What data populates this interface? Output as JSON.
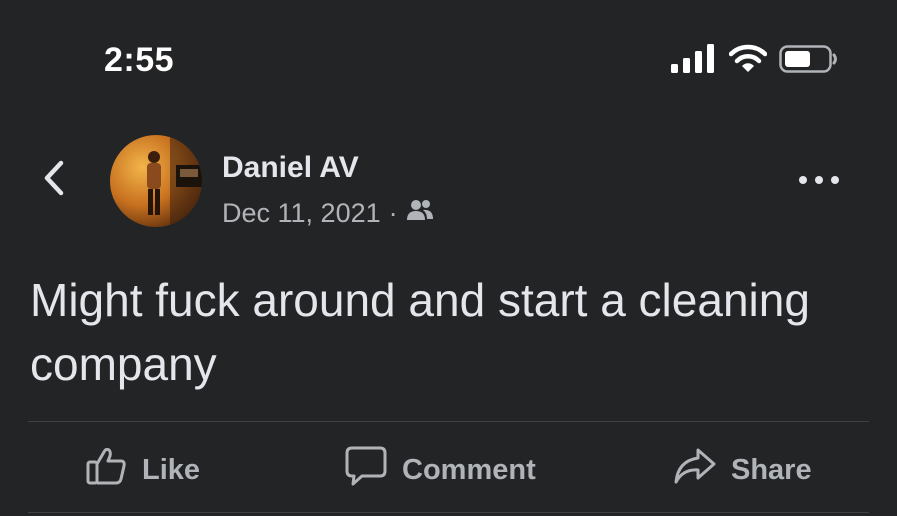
{
  "status_bar": {
    "time": "2:55",
    "icons": [
      "cellular-signal-icon",
      "wifi-icon",
      "battery-icon"
    ]
  },
  "nav": {
    "back_icon": "chevron-left-icon"
  },
  "post": {
    "author": "Daniel AV",
    "date": "Dec 11, 2021",
    "separator": "·",
    "audience_icon": "friends-icon",
    "text": "Might fuck around and start a cleaning company",
    "more_icon": "more-dots-icon"
  },
  "actions": {
    "like_label": "Like",
    "comment_label": "Comment",
    "share_label": "Share"
  },
  "colors": {
    "background": "#232425",
    "primary_text": "#e4e6eb",
    "secondary_text": "#b0b3b8",
    "divider": "#3e4042"
  }
}
